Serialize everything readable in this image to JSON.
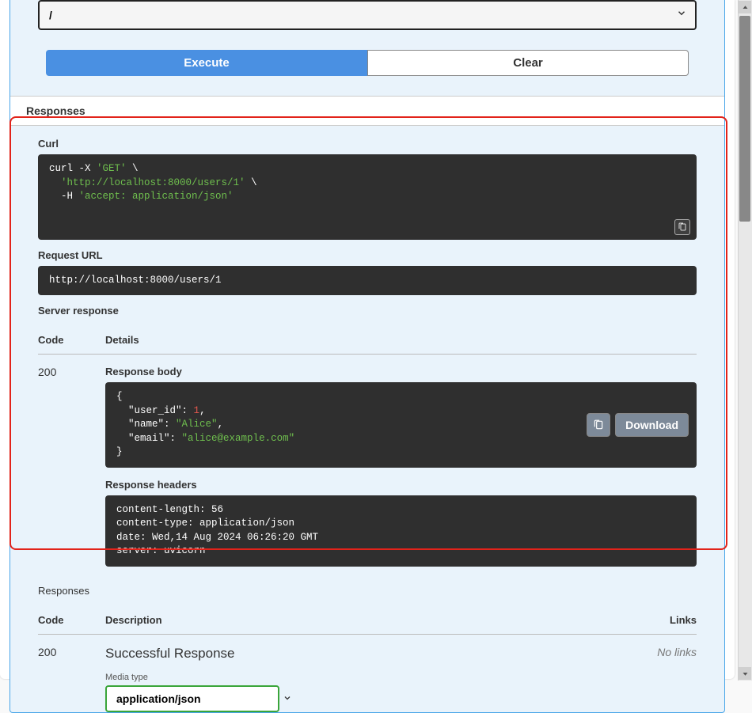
{
  "param_select_value": "/",
  "buttons": {
    "execute": "Execute",
    "clear": "Clear",
    "download": "Download"
  },
  "section_responses_title": "Responses",
  "labels": {
    "curl": "Curl",
    "request_url": "Request URL",
    "server_response": "Server response",
    "code": "Code",
    "details": "Details",
    "response_body": "Response body",
    "response_headers": "Response headers",
    "description": "Description",
    "links": "Links",
    "no_links": "No links",
    "media_type": "Media type"
  },
  "curl": {
    "cmd": "curl -X ",
    "method": "'GET'",
    "url": "'http://localhost:8000/users/1'",
    "header_flag": "  -H ",
    "header": "'accept: application/json'"
  },
  "request_url": "http://localhost:8000/users/1",
  "live_response": {
    "code": "200",
    "body": {
      "k1": "\"user_id\"",
      "v1": "1",
      "k2": "\"name\"",
      "v2": "\"Alice\"",
      "k3": "\"email\"",
      "v3": "\"alice@example.com\""
    },
    "headers": "content-length: 56 \ncontent-type: application/json \ndate: Wed,14 Aug 2024 06:26:20 GMT \nserver: uvicorn "
  },
  "documented_response": {
    "code": "200",
    "description": "Successful Response",
    "media_type": "application/json"
  }
}
